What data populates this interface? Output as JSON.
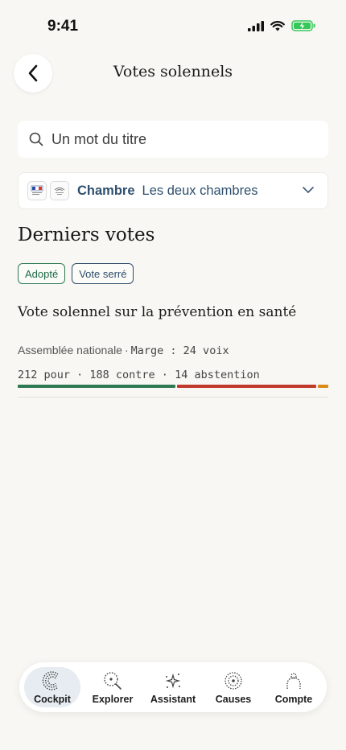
{
  "status": {
    "time": "9:41"
  },
  "header": {
    "title": "Votes solennels"
  },
  "search": {
    "placeholder": "Un mot du titre"
  },
  "chamber": {
    "label": "Chambre",
    "value": "Les deux chambres"
  },
  "section": {
    "title": "Derniers votes"
  },
  "vote": {
    "badges": [
      "Adopté",
      "Vote serré"
    ],
    "title": "Vote solennel sur la prévention en santé",
    "institution": "Assemblée nationale",
    "separator": "·",
    "margin": "Marge : 24 voix",
    "counts_text": "212 pour · 188 contre · 14 abstention",
    "for": 212,
    "against": 188,
    "abstention": 14,
    "colors": {
      "for": "#2f7a55",
      "against": "#c0392b",
      "abstention": "#d98a17"
    }
  },
  "tabs": [
    {
      "label": "Cockpit",
      "icon": "cockpit-icon",
      "active": true
    },
    {
      "label": "Explorer",
      "icon": "explorer-icon",
      "active": false
    },
    {
      "label": "Assistant",
      "icon": "assistant-icon",
      "active": false
    },
    {
      "label": "Causes",
      "icon": "causes-icon",
      "active": false
    },
    {
      "label": "Compte",
      "icon": "account-icon",
      "active": false
    }
  ]
}
